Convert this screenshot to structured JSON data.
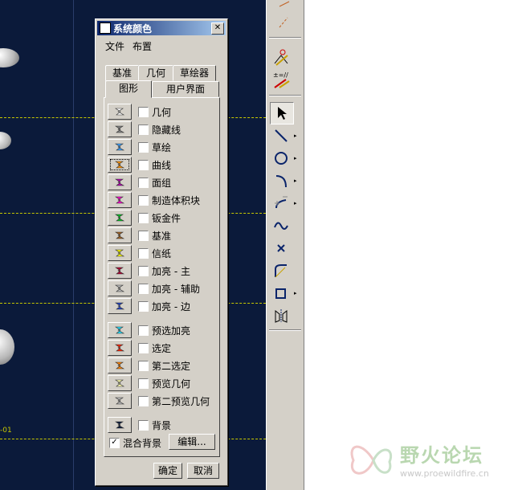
{
  "dialog": {
    "title": "系统颜色",
    "menu": [
      "文件",
      "布置"
    ],
    "tabs_back": [
      "基准",
      "几何",
      "草绘器"
    ],
    "tabs_front": [
      "图形",
      "用户界面"
    ],
    "items": [
      {
        "label": "几何",
        "color": "#ffffff"
      },
      {
        "label": "隐藏线",
        "color": "#808080"
      },
      {
        "label": "草绘",
        "color": "#3aa0ff"
      },
      {
        "label": "曲线",
        "color": "#ff9000"
      },
      {
        "label": "面组",
        "color": "#b000b0"
      },
      {
        "label": "制造体积块",
        "color": "#ff00d0"
      },
      {
        "label": "钣金件",
        "color": "#00c020"
      },
      {
        "label": "基准",
        "color": "#a06020"
      },
      {
        "label": "信纸",
        "color": "#ffff00"
      },
      {
        "label": "加亮 - 主",
        "color": "#b00030"
      },
      {
        "label": "加亮 - 辅助",
        "color": "#b8b8b8"
      },
      {
        "label": "加亮 - 边",
        "color": "#2040c0"
      },
      {
        "label": "预选加亮",
        "color": "#20e0ff"
      },
      {
        "label": "选定",
        "color": "#ff2000"
      },
      {
        "label": "第二选定",
        "color": "#ff8000"
      },
      {
        "label": "预览几何",
        "color": "#ffffb0"
      },
      {
        "label": "第二预览几何",
        "color": "#b8b8b8"
      },
      {
        "label": "背景",
        "color": "#0b1a3a"
      }
    ],
    "blend_bg_label": "混合背景",
    "edit_label": "编辑...",
    "ok_label": "确定",
    "cancel_label": "取消"
  },
  "watermark": {
    "title": "野火论坛",
    "url": "www.proewildfire.cn"
  },
  "viewport": {
    "label": "-01"
  }
}
